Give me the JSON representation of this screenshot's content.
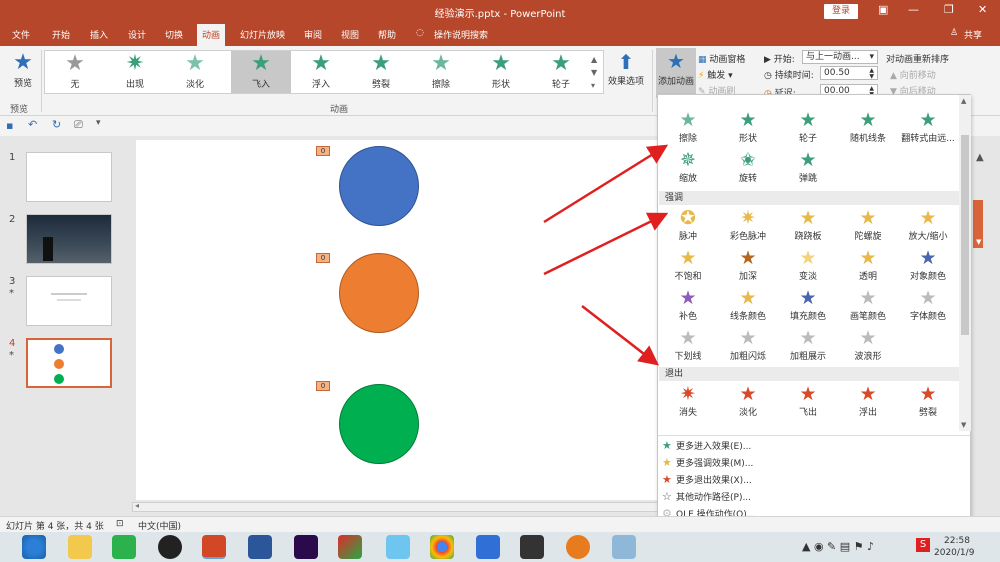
{
  "window": {
    "title": "经验演示.pptx  -  PowerPoint",
    "login": "登录",
    "share": "共享"
  },
  "tabs": [
    "文件",
    "开始",
    "插入",
    "设计",
    "切换",
    "动画",
    "幻灯片放映",
    "审阅",
    "视图",
    "帮助",
    "操作说明搜索"
  ],
  "ribbon": {
    "preview": "预览",
    "preview_group": "预览",
    "animation_group": "动画",
    "gallery": [
      "无",
      "出现",
      "淡化",
      "飞入",
      "浮入",
      "劈裂",
      "擦除",
      "形状",
      "轮子"
    ],
    "effect_options": "效果选项",
    "add_animation": "添加动画",
    "animation_pane": "动画窗格",
    "trigger": "触发",
    "animation_painter": "动画刷",
    "start_label": "开始:",
    "start_value": "与上一动画...",
    "duration_label": "持续时间:",
    "duration_value": "00.50",
    "delay_label": "延迟:",
    "delay_value": "00.00",
    "reorder": "对动画重新排序",
    "move_earlier": "向前移动",
    "move_later": "向后移动"
  },
  "thumbnails": [
    {
      "num": "1",
      "star": ""
    },
    {
      "num": "2",
      "star": ""
    },
    {
      "num": "3",
      "star": "*"
    },
    {
      "num": "4",
      "star": "*"
    }
  ],
  "slide": {
    "tags": [
      "0",
      "0",
      "0"
    ]
  },
  "dropdown": {
    "entrance_row1": [
      "擦除",
      "形状",
      "轮子",
      "随机线条",
      "翻转式由远..."
    ],
    "entrance_row2": [
      "缩放",
      "旋转",
      "弹跳"
    ],
    "emphasis_header": "强调",
    "emphasis_row1": [
      "脉冲",
      "彩色脉冲",
      "跷跷板",
      "陀螺旋",
      "放大/缩小"
    ],
    "emphasis_row2": [
      "不饱和",
      "加深",
      "变淡",
      "透明",
      "对象颜色"
    ],
    "emphasis_row3": [
      "补色",
      "线条颜色",
      "填充颜色",
      "画笔颜色",
      "字体颜色"
    ],
    "emphasis_row4": [
      "下划线",
      "加粗闪烁",
      "加粗展示",
      "波浪形"
    ],
    "exit_header": "退出",
    "exit_row1": [
      "消失",
      "淡化",
      "飞出",
      "浮出",
      "劈裂"
    ],
    "more": [
      "更多进入效果(E)...",
      "更多强调效果(M)...",
      "更多退出效果(X)...",
      "其他动作路径(P)...",
      "OLE 操作动作(O)..."
    ]
  },
  "status": {
    "slide_info": "幻灯片 第 4 张，共 4 张",
    "language": "中文(中国)"
  },
  "taskbar": {
    "time": "22:58",
    "date": "2020/1/9"
  },
  "colors": {
    "accent": "#b7472a",
    "circle1": "#4472c4",
    "circle2": "#ed7d31",
    "circle3": "#00b050",
    "arrow": "#e02020"
  }
}
